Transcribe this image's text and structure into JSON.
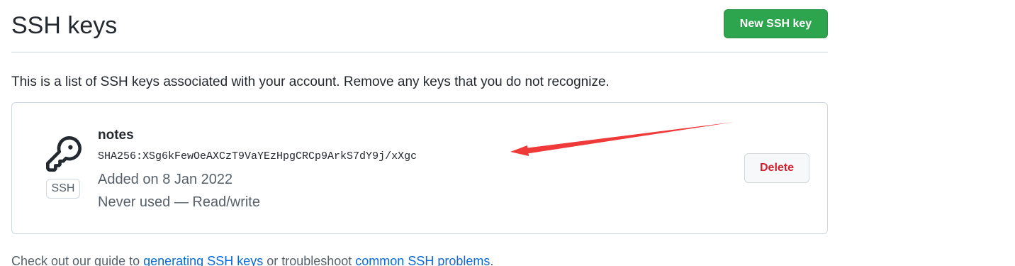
{
  "header": {
    "title": "SSH keys",
    "new_key_label": "New SSH key"
  },
  "intro": "This is a list of SSH keys associated with your account. Remove any keys that you do not recognize.",
  "keys": [
    {
      "title": "notes",
      "fingerprint": "SHA256:XSg6kFewOeAXCzT9VaYEzHpgCRCp9ArkS7dY9j/xXgc",
      "added": "Added on 8 Jan 2022",
      "usage": "Never used — Read/write",
      "type_label": "SSH",
      "icon": "key-icon",
      "delete_label": "Delete"
    }
  ],
  "footer": {
    "prefix": "Check out our guide to ",
    "link1": "generating SSH keys",
    "middle": " or troubleshoot ",
    "link2": "common SSH problems",
    "suffix": "."
  },
  "colors": {
    "primary_button": "#2da44e",
    "danger_text": "#cf222e",
    "link": "#0969da",
    "annotation": "#f03a3a"
  }
}
